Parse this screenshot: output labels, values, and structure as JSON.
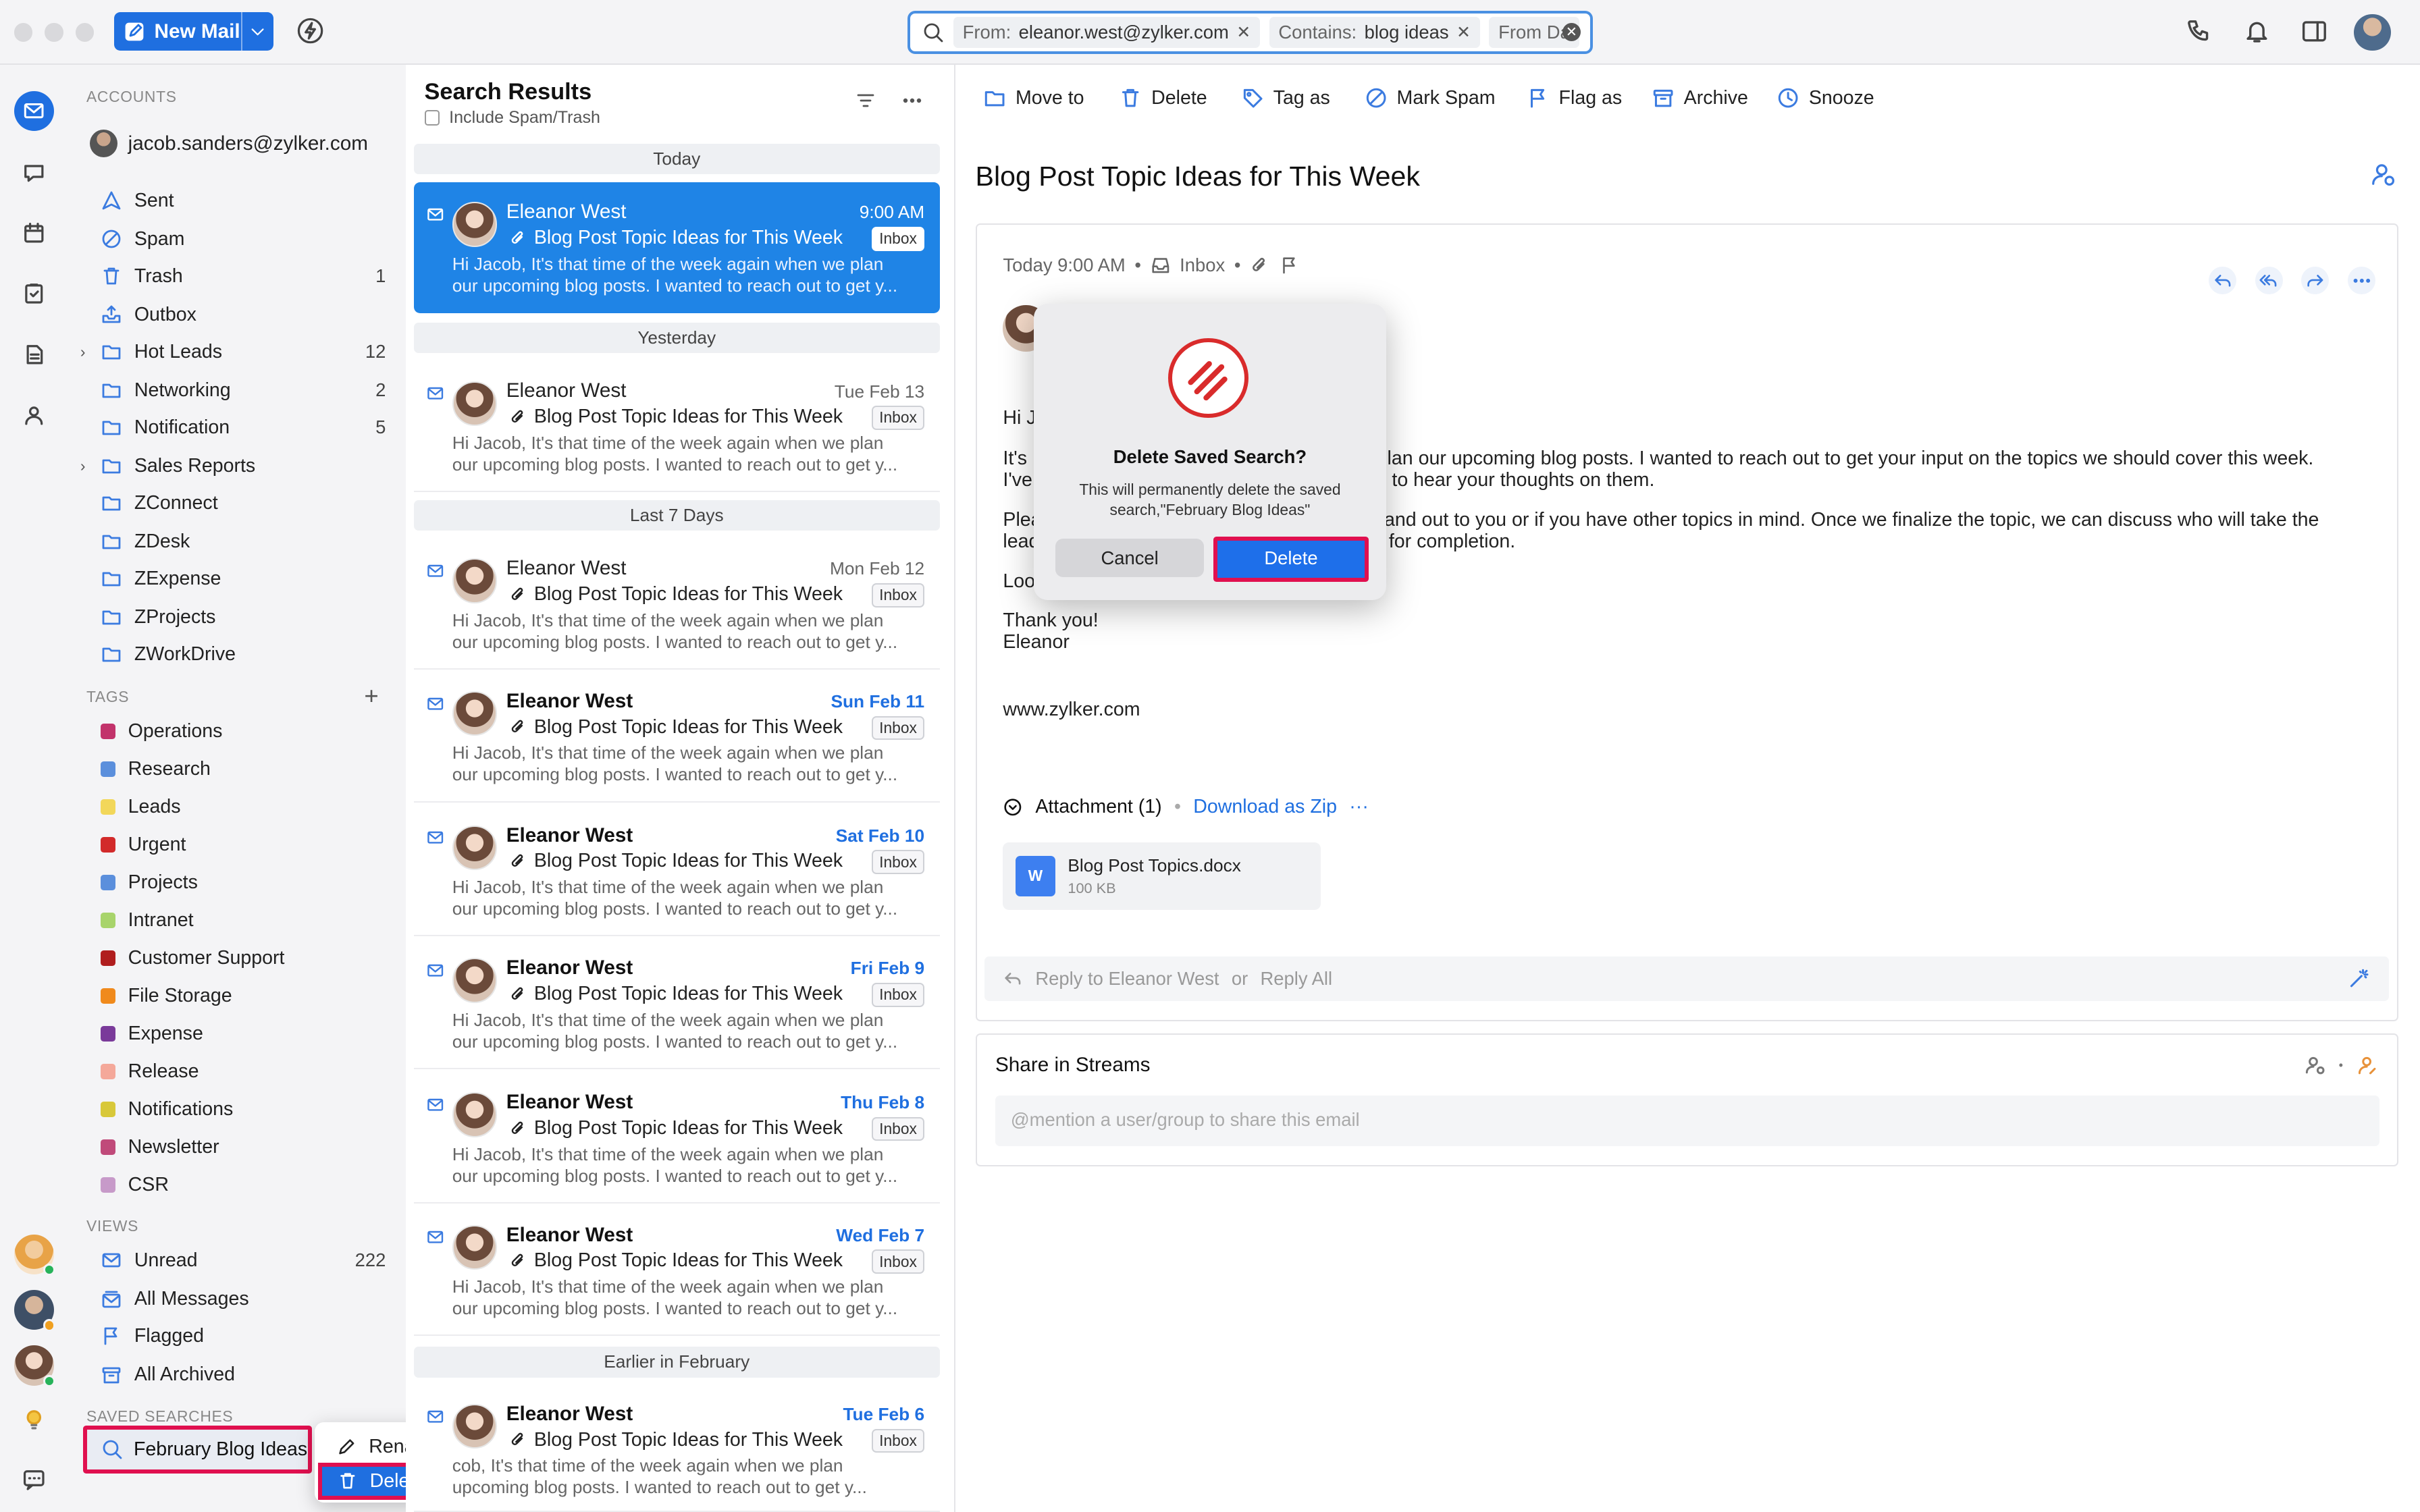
{
  "topbar": {
    "new_mail": "New Mail",
    "search_chips": [
      {
        "key": "From:",
        "value": "eleanor.west@zylker.com"
      },
      {
        "key": "Contains:",
        "value": "blog ideas"
      },
      {
        "key": "From Da",
        "value": ""
      }
    ]
  },
  "sidebar": {
    "accounts_label": "ACCOUNTS",
    "account_email": "jacob.sanders@zylker.com",
    "folders": [
      {
        "label": "Sent",
        "count": ""
      },
      {
        "label": "Spam",
        "count": ""
      },
      {
        "label": "Trash",
        "count": "1"
      },
      {
        "label": "Outbox",
        "count": ""
      },
      {
        "label": "Hot Leads",
        "count": "12"
      },
      {
        "label": "Networking",
        "count": "2"
      },
      {
        "label": "Notification",
        "count": "5"
      },
      {
        "label": "Sales Reports",
        "count": ""
      },
      {
        "label": "ZConnect",
        "count": ""
      },
      {
        "label": "ZDesk",
        "count": ""
      },
      {
        "label": "ZExpense",
        "count": ""
      },
      {
        "label": "ZProjects",
        "count": ""
      },
      {
        "label": "ZWorkDrive",
        "count": ""
      }
    ],
    "tags_label": "TAGS",
    "tags": [
      {
        "label": "Operations",
        "color": "#c2336b"
      },
      {
        "label": "Research",
        "color": "#5b8fdc"
      },
      {
        "label": "Leads",
        "color": "#f2d75a"
      },
      {
        "label": "Urgent",
        "color": "#d22a2a"
      },
      {
        "label": "Projects",
        "color": "#5b8fdc"
      },
      {
        "label": "Intranet",
        "color": "#a8d46b"
      },
      {
        "label": "Customer Support",
        "color": "#b01e1e"
      },
      {
        "label": "File Storage",
        "color": "#f08a1c"
      },
      {
        "label": "Expense",
        "color": "#7a3a9a"
      },
      {
        "label": "Release",
        "color": "#f4a89a"
      },
      {
        "label": "Notifications",
        "color": "#d8c83a"
      },
      {
        "label": "Newsletter",
        "color": "#c04a7a"
      },
      {
        "label": "CSR",
        "color": "#c79ac9"
      }
    ],
    "views_label": "VIEWS",
    "views": [
      {
        "label": "Unread",
        "count": "222"
      },
      {
        "label": "All Messages",
        "count": ""
      },
      {
        "label": "Flagged",
        "count": ""
      },
      {
        "label": "All Archived",
        "count": ""
      }
    ],
    "saved_label": "SAVED SEARCHES",
    "saved_search": "February Blog Ideas"
  },
  "context_menu": {
    "rename": "Rename",
    "delete": "Delete"
  },
  "list": {
    "title": "Search Results",
    "include": "Include Spam/Trash",
    "groups": [
      "Today",
      "Yesterday",
      "Last 7 Days",
      "Earlier in February"
    ],
    "items": [
      {
        "from": "Eleanor West",
        "date": "9:00 AM",
        "subject": "Blog Post Topic Ideas for This Week",
        "badge": "Inbox",
        "preview1": "Hi Jacob, It's that time of the week again when we plan",
        "preview2": "our upcoming blog posts. I wanted to reach out to get y..."
      },
      {
        "from": "Eleanor West",
        "date": "Tue Feb 13",
        "subject": "Blog Post Topic Ideas for This Week",
        "badge": "Inbox",
        "preview1": "Hi Jacob, It's that time of the week again when we plan",
        "preview2": "our upcoming blog posts. I wanted to reach out to get y..."
      },
      {
        "from": "Eleanor West",
        "date": "Mon Feb 12",
        "subject": "Blog Post Topic Ideas for This Week",
        "badge": "Inbox",
        "preview1": "Hi Jacob, It's that time of the week again when we plan",
        "preview2": "our upcoming blog posts. I wanted to reach out to get y..."
      },
      {
        "from": "Eleanor West",
        "date": "Sun Feb 11",
        "subject": "Blog Post Topic Ideas for This Week",
        "badge": "Inbox",
        "preview1": "Hi Jacob, It's that time of the week again when we plan",
        "preview2": "our upcoming blog posts. I wanted to reach out to get y..."
      },
      {
        "from": "Eleanor West",
        "date": "Sat Feb 10",
        "subject": "Blog Post Topic Ideas for This Week",
        "badge": "Inbox",
        "preview1": "Hi Jacob, It's that time of the week again when we plan",
        "preview2": "our upcoming blog posts. I wanted to reach out to get y..."
      },
      {
        "from": "Eleanor West",
        "date": "Fri Feb 9",
        "subject": "Blog Post Topic Ideas for This Week",
        "badge": "Inbox",
        "preview1": "Hi Jacob, It's that time of the week again when we plan",
        "preview2": "our upcoming blog posts. I wanted to reach out to get y..."
      },
      {
        "from": "Eleanor West",
        "date": "Thu Feb 8",
        "subject": "Blog Post Topic Ideas for This Week",
        "badge": "Inbox",
        "preview1": "Hi Jacob, It's that time of the week again when we plan",
        "preview2": "our upcoming blog posts. I wanted to reach out to get y..."
      },
      {
        "from": "Eleanor West",
        "date": "Wed Feb 7",
        "subject": "Blog Post Topic Ideas for This Week",
        "badge": "Inbox",
        "preview1": "Hi Jacob, It's that time of the week again when we plan",
        "preview2": "our upcoming blog posts. I wanted to reach out to get y..."
      },
      {
        "from": "Eleanor West",
        "date": "Tue Feb 6",
        "subject": "Blog Post Topic Ideas for This Week",
        "badge": "Inbox",
        "preview1": "cob, It's that time of the week again when we plan",
        "preview2": "upcoming blog posts. I wanted to reach out to get y..."
      }
    ]
  },
  "toolbar": {
    "move_to": "Move to",
    "delete": "Delete",
    "tag_as": "Tag as",
    "mark_spam": "Mark Spam",
    "flag_as": "Flag as",
    "archive": "Archive",
    "snooze": "Snooze"
  },
  "mail": {
    "title": "Blog Post Topic Ideas for This Week",
    "time": "Today 9:00 AM",
    "folder": "Inbox",
    "lines": {
      "greet": "Hi J",
      "p1a": "It's",
      "p1a_r": "lan our upcoming blog posts. I wanted to reach out to get your input on the topics we should cover this week.",
      "p1b": "I've",
      "p1b_r": "to hear your thoughts on them.",
      "p2a": "Plea",
      "p2a_r": "and out to you or if you have other topics in mind. Once we finalize the topic, we can discuss who will take the",
      "p2b": "lead",
      "p2b_r": "for completion.",
      "p3": "Loo",
      "thanks": "Thank you!",
      "name": "Eleanor",
      "site": "www.zylker.com"
    },
    "attachment_label": "Attachment (1)",
    "download_zip": "Download as Zip",
    "file_name": "Blog Post Topics.docx",
    "file_size": "100 KB",
    "reply_to": "Reply to Eleanor West",
    "or": "or",
    "reply_all": "Reply All"
  },
  "streams": {
    "title": "Share in Streams",
    "placeholder": "@mention a user/group to share this email"
  },
  "dialog": {
    "title": "Delete Saved Search?",
    "message": "This will permanently delete the saved search,\"February Blog Ideas\"",
    "cancel": "Cancel",
    "delete": "Delete"
  }
}
